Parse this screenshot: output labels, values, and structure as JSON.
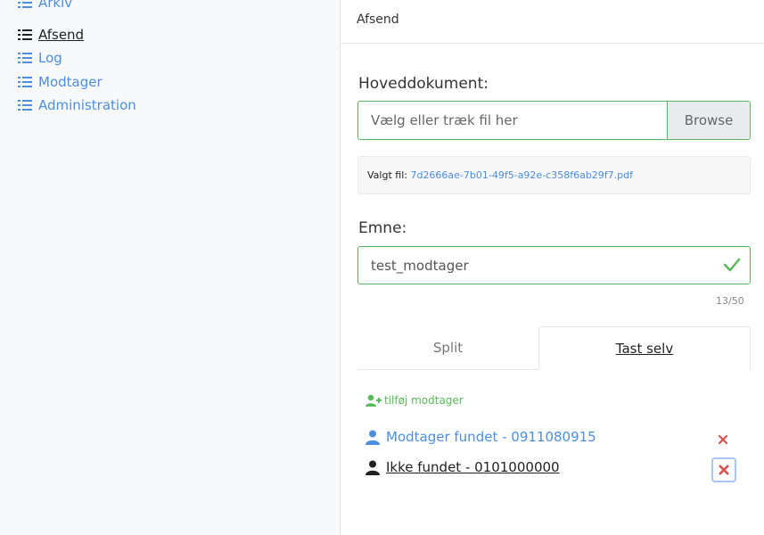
{
  "sidebar": {
    "items": [
      {
        "label": "Arkiv",
        "icon": "list-icon"
      },
      {
        "label": "Afsend",
        "icon": "list-icon",
        "active": true
      },
      {
        "label": "Log",
        "icon": "list-icon"
      },
      {
        "label": "Modtager",
        "icon": "list-icon"
      },
      {
        "label": "Administration",
        "icon": "list-icon"
      }
    ]
  },
  "header": {
    "title": "Afsend"
  },
  "form": {
    "main_doc_label": "Hoveddokument:",
    "file_placeholder": "Vælg eller træk fil her",
    "browse_label": "Browse",
    "selected_file_label": "Valgt fil:",
    "selected_file_name": "7d2666ae-7b01-49f5-a92e-c358f6ab29f7.pdf",
    "subject_label": "Emne:",
    "subject_value": "test_modtager",
    "subject_counter": "13/50"
  },
  "tabs": [
    {
      "label": "Split"
    },
    {
      "label": "Tast selv",
      "active": true
    }
  ],
  "recipients": {
    "add_label": "tilføj modtager",
    "items": [
      {
        "label": "Modtager fundet - 0911080915",
        "status": "found"
      },
      {
        "label": "Ikke fundet - 0101000000",
        "status": "not-found"
      }
    ]
  },
  "colors": {
    "accent": "#4c8ee0",
    "success": "#5cb85c",
    "danger": "#d9534f"
  }
}
